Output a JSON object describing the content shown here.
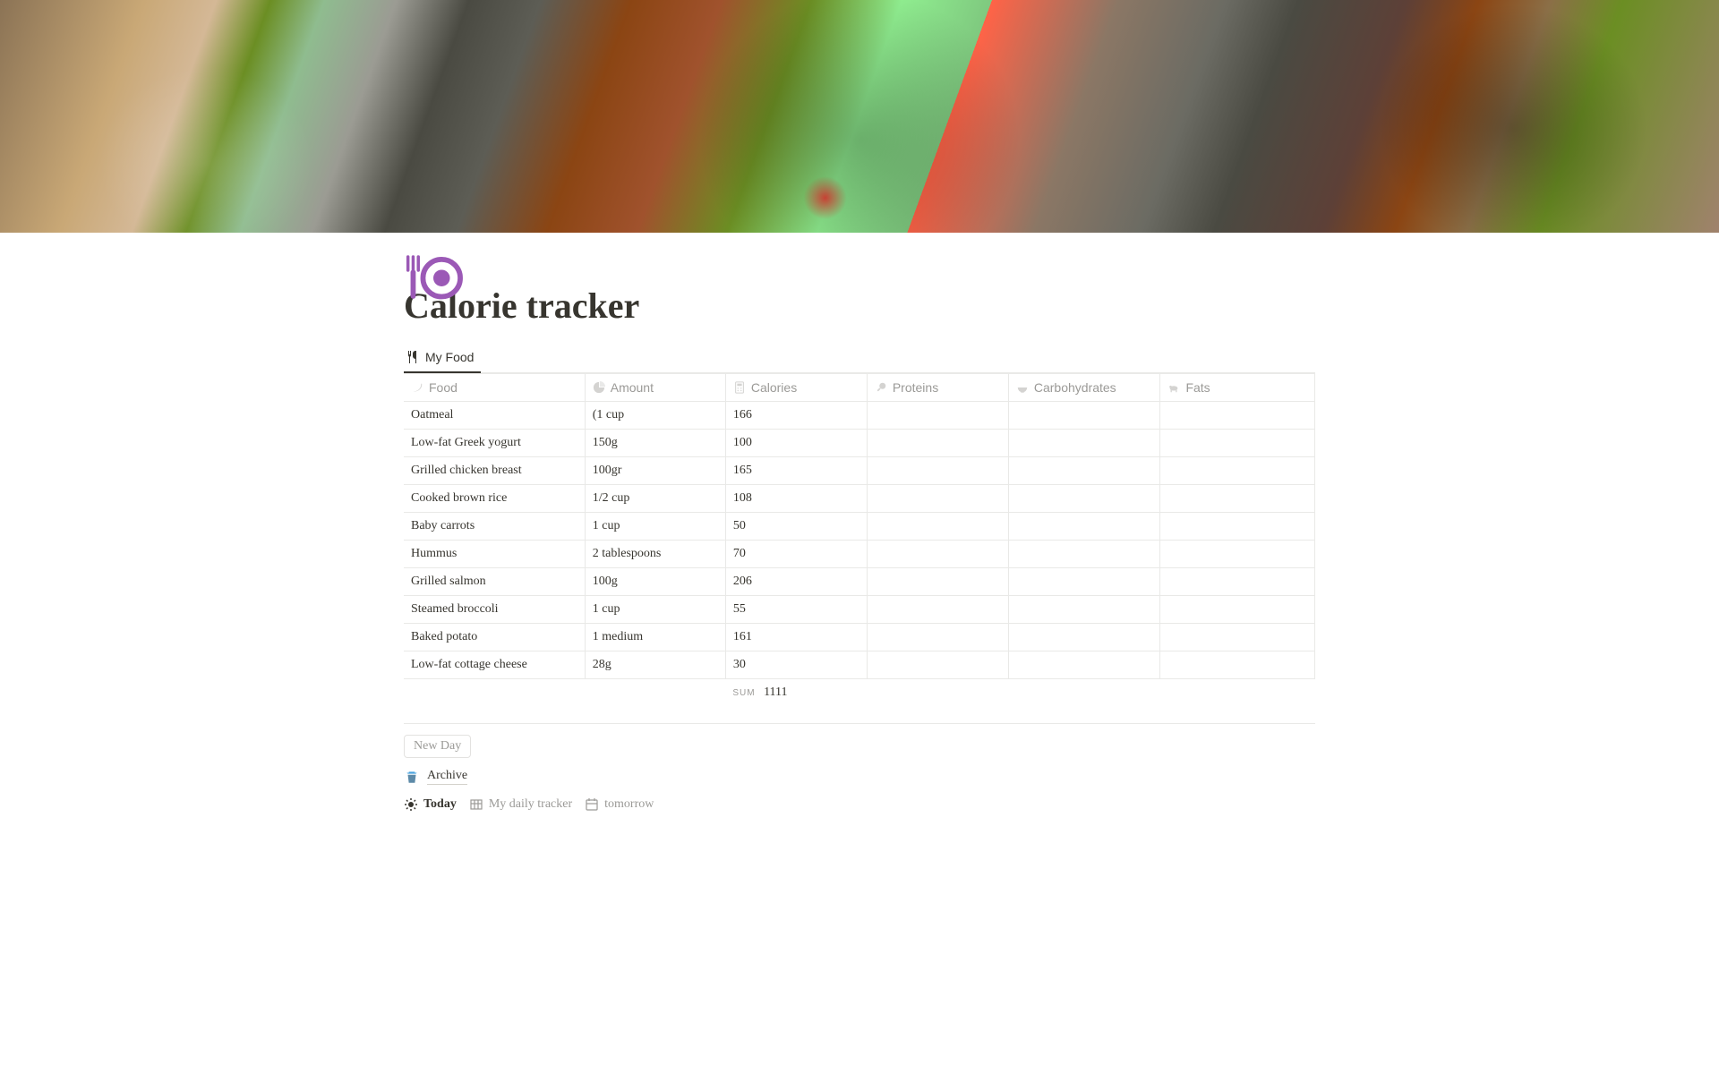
{
  "page": {
    "title": "Calorie tracker",
    "icon_name": "fork-plate-icon"
  },
  "tabs": [
    {
      "label": "My Food",
      "icon": "utensils-icon"
    }
  ],
  "columns": [
    {
      "key": "food",
      "label": "Food",
      "icon": "banana-icon"
    },
    {
      "key": "amount",
      "label": "Amount",
      "icon": "progress-icon"
    },
    {
      "key": "calories",
      "label": "Calories",
      "icon": "calculator-icon"
    },
    {
      "key": "proteins",
      "label": "Proteins",
      "icon": "drumstick-icon"
    },
    {
      "key": "carbs",
      "label": "Carbohydrates",
      "icon": "bowl-icon"
    },
    {
      "key": "fats",
      "label": "Fats",
      "icon": "cow-icon"
    }
  ],
  "rows": [
    {
      "food": "Oatmeal",
      "amount": "(1 cup",
      "calories": 166,
      "proteins": "",
      "carbs": "",
      "fats": ""
    },
    {
      "food": "Low-fat Greek yogurt",
      "amount": "150g",
      "calories": 100,
      "proteins": "",
      "carbs": "",
      "fats": ""
    },
    {
      "food": "Grilled chicken breast",
      "amount": "100gr",
      "calories": 165,
      "proteins": "",
      "carbs": "",
      "fats": ""
    },
    {
      "food": "Cooked brown rice",
      "amount": "1/2 cup",
      "calories": 108,
      "proteins": "",
      "carbs": "",
      "fats": ""
    },
    {
      "food": "Baby carrots",
      "amount": "1 cup",
      "calories": 50,
      "proteins": "",
      "carbs": "",
      "fats": ""
    },
    {
      "food": "Hummus",
      "amount": "2 tablespoons",
      "calories": 70,
      "proteins": "",
      "carbs": "",
      "fats": ""
    },
    {
      "food": "Grilled salmon",
      "amount": "100g",
      "calories": 206,
      "proteins": "",
      "carbs": "",
      "fats": ""
    },
    {
      "food": "Steamed broccoli",
      "amount": "1 cup",
      "calories": 55,
      "proteins": "",
      "carbs": "",
      "fats": ""
    },
    {
      "food": "Baked potato",
      "amount": "1 medium",
      "calories": 161,
      "proteins": "",
      "carbs": "",
      "fats": ""
    },
    {
      "food": "Low-fat cottage cheese",
      "amount": "28g",
      "calories": 30,
      "proteins": "",
      "carbs": "",
      "fats": ""
    }
  ],
  "summary": {
    "label": "SUM",
    "calories": 1111
  },
  "actions": {
    "new_day": "New Day"
  },
  "links": {
    "archive": {
      "label": "Archive",
      "icon": "trash-icon"
    },
    "inline": [
      {
        "label": "Today",
        "icon": "sun-icon",
        "active": true
      },
      {
        "label": "My daily tracker",
        "icon": "table-icon",
        "active": false
      },
      {
        "label": "tomorrow",
        "icon": "calendar-icon",
        "active": false
      }
    ]
  }
}
